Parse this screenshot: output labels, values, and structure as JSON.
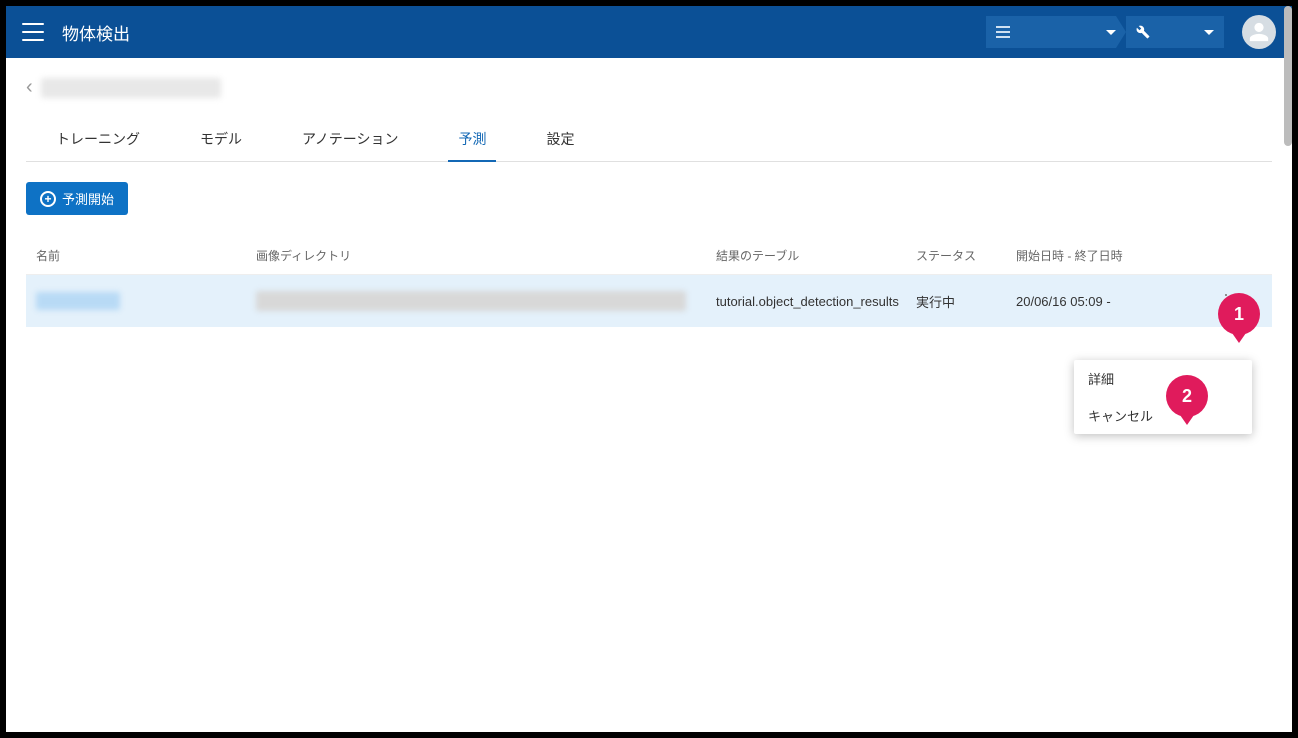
{
  "header": {
    "app_title": "物体検出"
  },
  "tabs": [
    {
      "label": "トレーニング",
      "active": false
    },
    {
      "label": "モデル",
      "active": false
    },
    {
      "label": "アノテーション",
      "active": false
    },
    {
      "label": "予測",
      "active": true
    },
    {
      "label": "設定",
      "active": false
    }
  ],
  "start_button": "予測開始",
  "table": {
    "headers": {
      "name": "名前",
      "image_dir": "画像ディレクトリ",
      "result_table": "結果のテーブル",
      "status": "ステータス",
      "datetime": "開始日時 - 終了日時"
    },
    "row": {
      "result_table": "tutorial.object_detection_results",
      "status": "実行中",
      "datetime": "20/06/16 05:09 -"
    }
  },
  "menu": {
    "detail": "詳細",
    "cancel": "キャンセル"
  },
  "callouts": {
    "c1": "1",
    "c2": "2"
  }
}
